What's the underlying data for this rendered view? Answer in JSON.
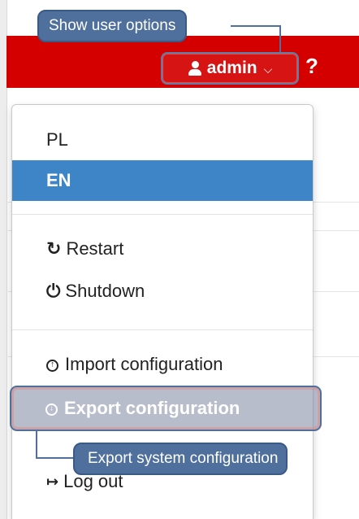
{
  "header": {
    "user_label": "admin",
    "user_icon": "user-icon",
    "caret_icon": "chevron-down-icon",
    "help_label": "?",
    "bar_color": "#d40000"
  },
  "tooltips": {
    "user_options": "Show user options",
    "export": "Export system configuration",
    "color": "#4f6f9c"
  },
  "menu": {
    "languages": [
      {
        "label": "PL",
        "active": false
      },
      {
        "label": "EN",
        "active": true
      }
    ],
    "restart": {
      "label": "Restart",
      "icon": "refresh-icon"
    },
    "shutdown": {
      "label": "Shutdown",
      "icon": "power-icon"
    },
    "import": {
      "label": "Import configuration",
      "icon": "circle-up-arrow-icon"
    },
    "export": {
      "label": "Export configuration",
      "icon": "circle-down-arrow-icon"
    },
    "logout": {
      "label": "Log out",
      "icon": "sign-out-icon"
    },
    "active_color": "#3d85c6"
  }
}
